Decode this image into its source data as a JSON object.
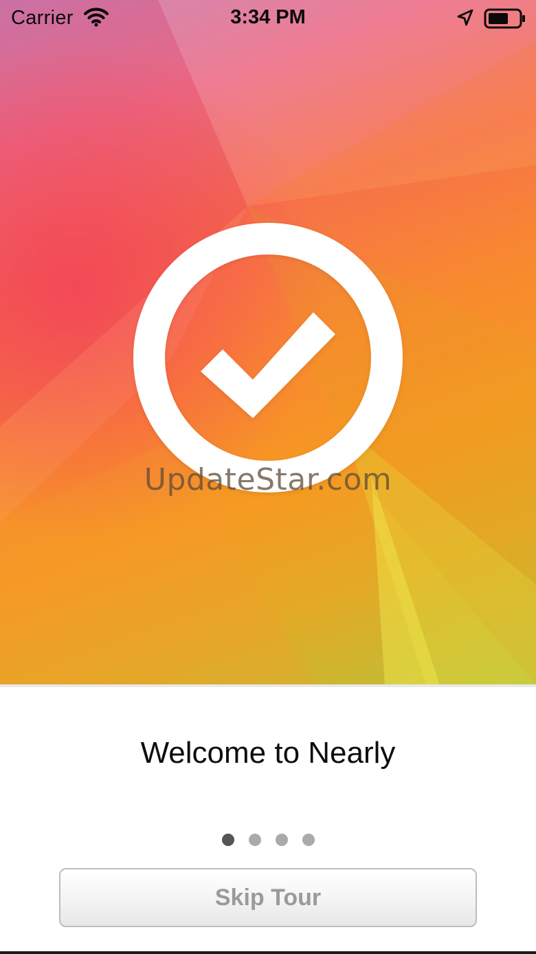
{
  "status_bar": {
    "carrier": "Carrier",
    "time": "3:34 PM",
    "icons": [
      "wifi-icon",
      "location-arrow-icon",
      "battery-icon"
    ]
  },
  "hero": {
    "badge_icon": "checkmark-circle-icon",
    "watermark": "UpdateStar.com",
    "colors": {
      "pink": "#ec6f88",
      "red": "#f6533f",
      "orange": "#f88a2e",
      "yellow": "#e2c23a",
      "green": "#b3c43a"
    }
  },
  "onboarding": {
    "title": "Welcome to Nearly",
    "page_count": 4,
    "current_page": 1,
    "skip_label": "Skip Tour"
  }
}
